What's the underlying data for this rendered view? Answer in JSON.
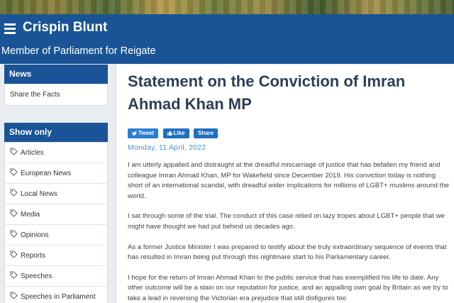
{
  "header": {
    "site_title": "Crispin Blunt",
    "subtitle": "Member of Parliament for Reigate"
  },
  "sidebar": {
    "news_heading": "News",
    "news_items": [
      {
        "label": "Share the Facts"
      }
    ],
    "show_only_heading": "Show only",
    "show_only_items": [
      {
        "label": "Articles"
      },
      {
        "label": "European News"
      },
      {
        "label": "Local News"
      },
      {
        "label": "Media"
      },
      {
        "label": "Opinions"
      },
      {
        "label": "Reports"
      },
      {
        "label": "Speeches"
      },
      {
        "label": "Speeches in Parliament"
      }
    ]
  },
  "article": {
    "title": "Statement on the Conviction of Imran Ahmad Khan MP",
    "share": {
      "tweet": "Tweet",
      "like": "Like",
      "share": "Share"
    },
    "date": "Monday, 11 April, 2022",
    "paragraphs": [
      "I am utterly appalled and distraught at the dreadful miscarriage of justice that has befallen my friend and colleague Imran Ahmad Khan, MP for Wakefield since December 2019.  His conviction today is nothing short of an international scandal, with dreadful wider implications for millions of LGBT+ muslims around the world.",
      "I sat through some of the trial. The conduct of this case relied on lazy tropes about LGBT+ people that we might have thought we had put behind us decades ago.",
      "As a former Justice Minister I was prepared to testify about the truly extraordinary sequence of events that has resulted in Imran being put through this nightmare start to his Parliamentary career.",
      "I hope for the return of Imran Ahmad Khan to the public service that has exemplified his life to date. Any other outcome will be a stain on our reputation for justice, and an appalling own goal by Britain as we try to take a lead in reversing the Victorian era prejudice that still disfigures too"
    ]
  },
  "colors": {
    "header_blue": "#1a5496",
    "title_navy": "#2d3e55",
    "date_blue": "#4d8ecd"
  }
}
